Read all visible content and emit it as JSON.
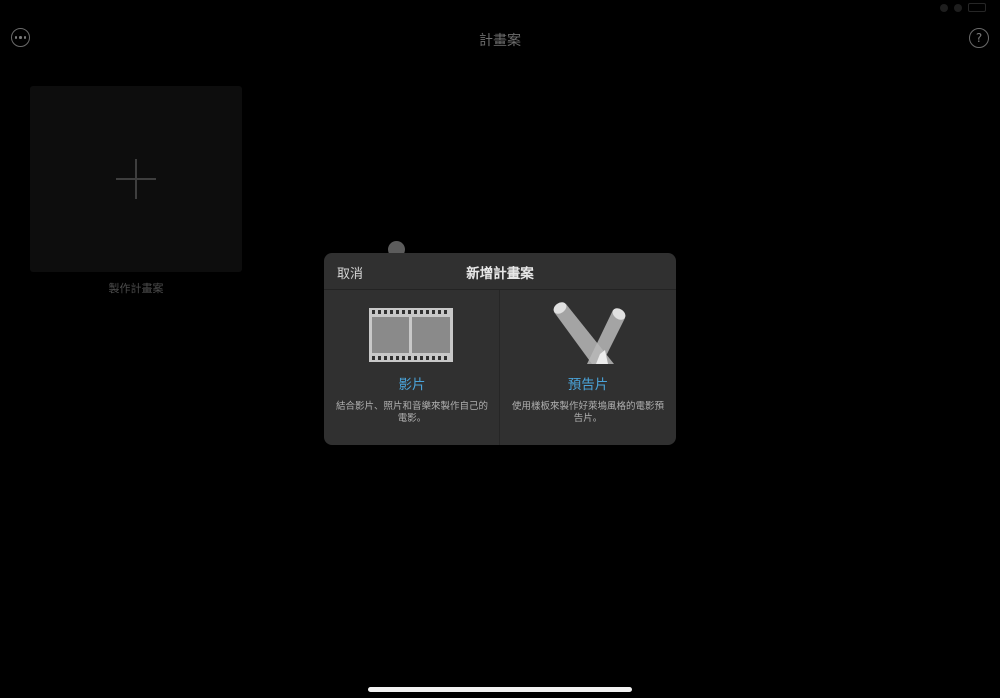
{
  "header": {
    "title": "計畫案"
  },
  "icons": {
    "more": "ellipsis-circle-icon",
    "help": "question-circle-icon",
    "help_glyph": "?",
    "new_project": "plus-icon",
    "movie": "film-strip-icon",
    "trailer": "spotlights-icon"
  },
  "projects": {
    "new_project_label": "製作計畫案"
  },
  "dialog": {
    "cancel_label": "取消",
    "title": "新增計畫案",
    "options": [
      {
        "label": "影片",
        "description": "結合影片、照片和音樂來製作自己的電影。"
      },
      {
        "label": "預告片",
        "description": "使用樣板來製作好萊塢風格的電影預告片。"
      }
    ]
  },
  "colors": {
    "accent": "#4aa3d9",
    "background": "#000000",
    "dialog_background": "#303030"
  }
}
